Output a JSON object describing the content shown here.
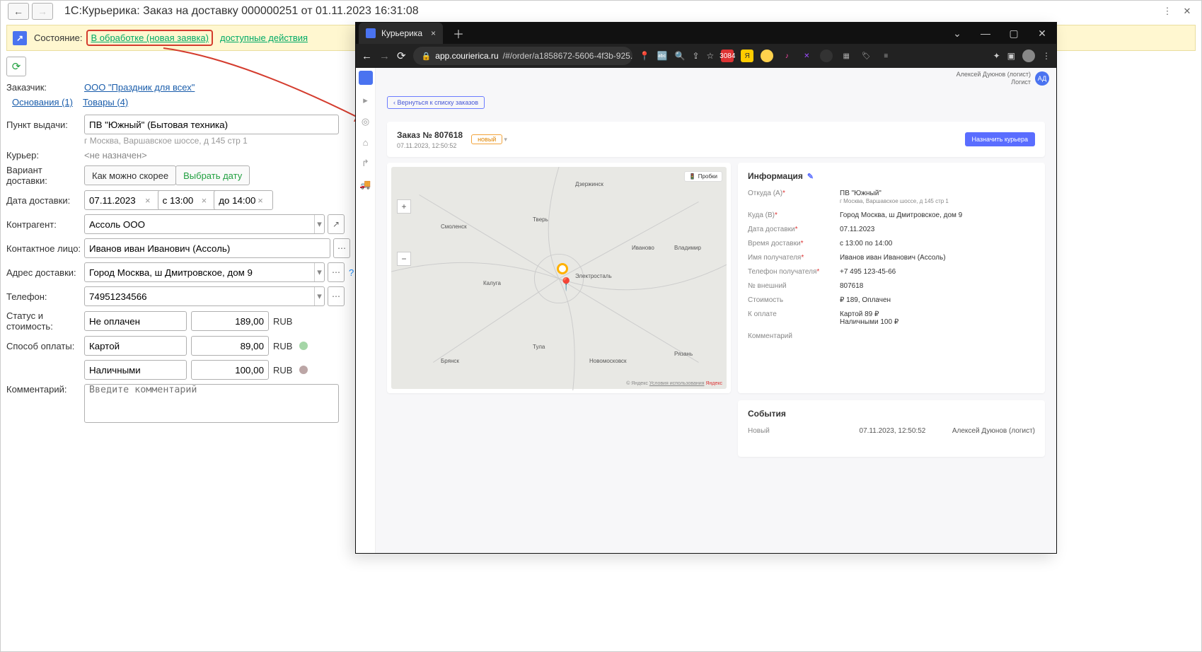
{
  "window1c": {
    "title": "1С:Курьерика: Заказ на доставку 000000251 от 01.11.2023 16:31:08",
    "state_label": "Состояние:",
    "state_link": "В обработке (новая заявка)",
    "actions_link": "доступные действия"
  },
  "form": {
    "customer_label": "Заказчик:",
    "customer_link": "ООО \"Праздник для всех\"",
    "tab_bases": "Основания (1)",
    "tab_goods": "Товары (4)",
    "pickup_label": "Пункт выдачи:",
    "pickup_value": "ПВ \"Южный\" (Бытовая техника)",
    "pickup_addr": "г Москва, Варшавское шоссе, д 145 стр 1",
    "courier_label": "Курьер:",
    "courier_value": "<не назначен>",
    "dvar_label": "Вариант доставки:",
    "dvar_btn1": "Как можно скорее",
    "dvar_btn2": "Выбрать дату",
    "ddate_label": "Дата доставки:",
    "ddate_value": "07.11.2023",
    "ddate_from": "с 13:00",
    "ddate_to": "до 14:00",
    "contr_label": "Контрагент:",
    "contr_value": "Ассоль ООО",
    "contact_label": "Контактное лицо:",
    "contact_value": "Иванов иван Иванович (Ассоль)",
    "addr_label": "Адрес доставки:",
    "addr_value": "Город Москва, ш Дмитровское, дом 9",
    "tel_label": "Телефон:",
    "tel_value": "74951234566",
    "paystat_label": "Статус и стоимость:",
    "paystat_value": "Не оплачен",
    "total": "189,00",
    "cur": "RUB",
    "paymethod_label": "Способ оплаты:",
    "pm_card": "Картой",
    "pm_card_sum": "89,00",
    "pm_cash": "Наличными",
    "pm_cash_sum": "100,00",
    "comment_label": "Комментарий:",
    "comment_placeholder": "Введите комментарий"
  },
  "browser": {
    "tab_title": "Курьерика",
    "url_host": "app.courierica.ru",
    "url_path": "/#/order/a1858672-5606-4f3b-925...",
    "user_name": "Алексей Дуюнов (логист)",
    "user_role": "Логист",
    "user_initials": "АД",
    "back_link": "Вернуться к списку заказов"
  },
  "order": {
    "title": "Заказ № 807618",
    "badge": "новый",
    "datetime": "07.11.2023, 12:50:52",
    "assign_btn": "Назначить курьера"
  },
  "map": {
    "traffic": "Пробки",
    "copyright_prefix": "© Яндекс",
    "copyright_terms": "Условия использования",
    "yandex": "Яндекс",
    "cities": [
      "Дзержинск",
      "Тверь",
      "Смоленск",
      "Иваново",
      "Калуга",
      "Электросталь",
      "Владимир",
      "Тула",
      "Новомосковск",
      "Брянск",
      "Рязань"
    ]
  },
  "info": {
    "heading": "Информация",
    "from_label": "Откуда (A)",
    "from_val": "ПВ \"Южный\"",
    "from_addr": "г Москва, Варшавское шоссе, д 145 стр 1",
    "to_label": "Куда (B)",
    "to_val": "Город Москва, ш Дмитровское, дом 9",
    "date_label": "Дата доставки",
    "date_val": "07.11.2023",
    "time_label": "Время доставки",
    "time_val": "с 13:00 по 14:00",
    "recv_label": "Имя получателя",
    "recv_val": "Иванов иван Иванович (Ассоль)",
    "tel_label": "Телефон получателя",
    "tel_val": "+7 495 123-45-66",
    "ext_label": "№ внешний",
    "ext_val": "807618",
    "cost_label": "Стоимость",
    "cost_val": "₽ 189, Оплачен",
    "pay_label": "К оплате",
    "pay_card": "Картой 89 ₽",
    "pay_cash": "Наличными 100 ₽",
    "comment_label": "Комментарий"
  },
  "events": {
    "heading": "События",
    "status": "Новый",
    "dt": "07.11.2023, 12:50:52",
    "user": "Алексей Дуюнов (логист)"
  }
}
